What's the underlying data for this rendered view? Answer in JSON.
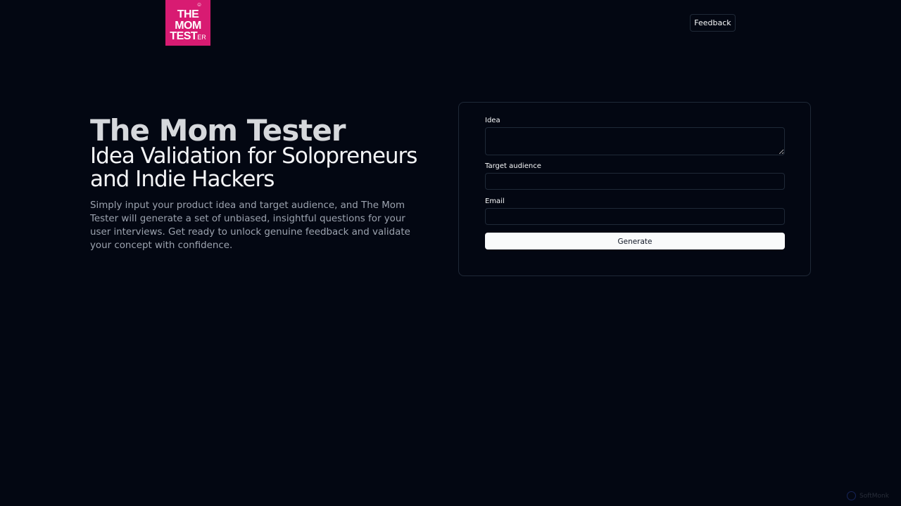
{
  "header": {
    "logo": {
      "line1": "THE",
      "line2": "MOM",
      "line3_main": "TEST",
      "line3_small": "ER",
      "mark": "☺",
      "bg_color": "#d81b72"
    },
    "feedback_label": "Feedback"
  },
  "hero": {
    "title": "The Mom Tester",
    "subtitle": "Idea Validation for Solopreneurs and Indie Hackers",
    "description": "Simply input your product idea and target audience, and The Mom Tester will generate a set of unbiased, insightful questions for your user interviews. Get ready to unlock genuine feedback and validate your concept with confidence."
  },
  "form": {
    "idea": {
      "label": "Idea",
      "value": "",
      "placeholder": ""
    },
    "target_audience": {
      "label": "Target audience",
      "value": "",
      "placeholder": ""
    },
    "email": {
      "label": "Email",
      "value": "",
      "placeholder": ""
    },
    "generate_label": "Generate"
  },
  "watermark": {
    "text": "SoftMonk",
    "icon": "circle-logo-icon"
  },
  "colors": {
    "background": "#030712",
    "border": "#1f2937",
    "text": "#f9fafb",
    "muted_text": "#9ca3af",
    "button_bg": "#f9fafb",
    "brand": "#d81b72"
  }
}
